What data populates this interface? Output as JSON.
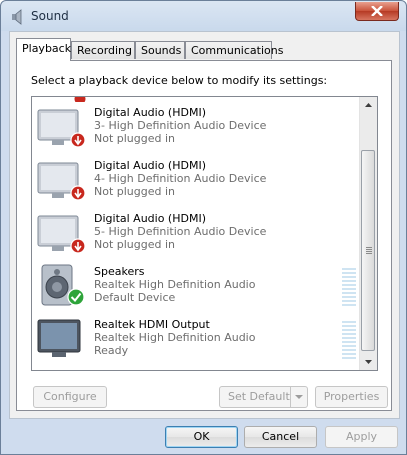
{
  "window": {
    "title": "Sound",
    "icon": "speaker-icon",
    "close": "close-icon"
  },
  "tabs": [
    {
      "label": "Playback",
      "active": true
    },
    {
      "label": "Recording",
      "active": false
    },
    {
      "label": "Sounds",
      "active": false
    },
    {
      "label": "Communications",
      "active": false
    }
  ],
  "instruction": "Select a playback device below to modify its settings:",
  "devices": [
    {
      "name": "Digital Audio (HDMI)",
      "description": "3- High Definition Audio Device",
      "status": "Not plugged in",
      "icon": "monitor-unplugged-icon"
    },
    {
      "name": "Digital Audio (HDMI)",
      "description": "4- High Definition Audio Device",
      "status": "Not plugged in",
      "icon": "monitor-unplugged-icon"
    },
    {
      "name": "Digital Audio (HDMI)",
      "description": "5- High Definition Audio Device",
      "status": "Not plugged in",
      "icon": "monitor-unplugged-icon"
    },
    {
      "name": "Speakers",
      "description": "Realtek High Definition Audio",
      "status": "Default Device",
      "icon": "speaker-default-icon"
    },
    {
      "name": "Realtek HDMI Output",
      "description": "Realtek High Definition Audio",
      "status": "Ready",
      "icon": "monitor-icon"
    }
  ],
  "buttons": {
    "configure": "Configure",
    "set_default": "Set Default",
    "properties": "Properties",
    "ok": "OK",
    "cancel": "Cancel",
    "apply": "Apply"
  },
  "colors": {
    "status_text": "#6d6d6d",
    "default_check": "#2ea43a",
    "unplugged": "#c8281e"
  }
}
